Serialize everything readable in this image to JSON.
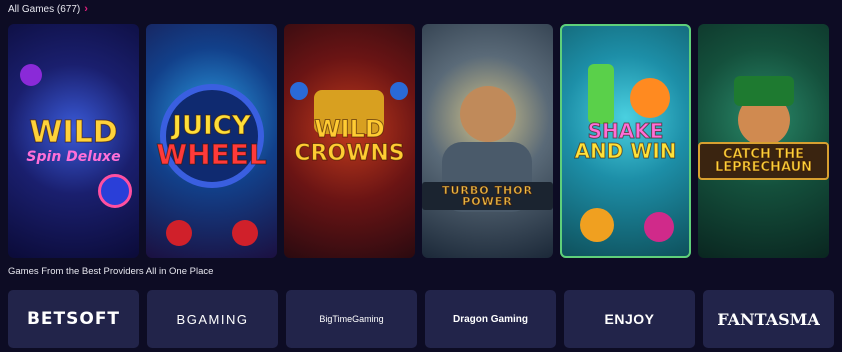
{
  "all_games": {
    "title": "All Games (677)",
    "chevron": "›",
    "games": [
      {
        "title": "Wild",
        "subtitle": "Spin Deluxe"
      },
      {
        "title": "Juicy",
        "subtitle": "Wheel"
      },
      {
        "title": "Wild",
        "subtitle": "Crowns"
      },
      {
        "title": "TURBO THOR POWER"
      },
      {
        "title": "Shake",
        "subtitle": "Win",
        "joiner": "and"
      },
      {
        "title": "Catch the Leprechaun"
      }
    ]
  },
  "providers": {
    "title": "Games From the Best Providers All in One Place",
    "items": [
      {
        "name": "BETSOFT"
      },
      {
        "name": "BGAMING"
      },
      {
        "name": "BigTimeGaming"
      },
      {
        "name": "Dragon Gaming"
      },
      {
        "name": "ENJOY"
      },
      {
        "name": "FANTASMA"
      }
    ]
  },
  "colors": {
    "background": "#0d0c24",
    "accent": "#e0207e",
    "provider_card": "#22244a",
    "active_outline": "#5fd07a"
  }
}
